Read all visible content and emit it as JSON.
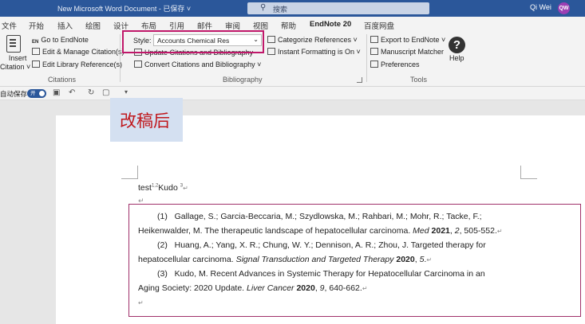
{
  "titlebar": {
    "doc_title": "New Microsoft Word Document  -  已保存  ˅",
    "search_placeholder": "搜索",
    "user_name": "Qi Wei",
    "avatar_initials": "QW"
  },
  "menu": {
    "tabs": [
      "文件",
      "开始",
      "插入",
      "绘图",
      "设计",
      "布局",
      "引用",
      "邮件",
      "审阅",
      "视图",
      "帮助",
      "EndNote 20",
      "百度网盘"
    ]
  },
  "ribbon": {
    "citations": {
      "insert_label_1": "Insert",
      "insert_label_2": "Citation ˅",
      "go_to": "Go to EndNote",
      "edit_manage": "Edit & Manage Citation(s)",
      "edit_library": "Edit Library Reference(s)",
      "group_label": "Citations"
    },
    "bibliography": {
      "style_label": "Style:",
      "style_value": "Accounts Chemical Res",
      "update": "Update Citations and Bibliography",
      "convert": "Convert Citations and Bibliography ˅",
      "categorize": "Categorize References ˅",
      "instant": "Instant Formatting is On ˅",
      "group_label": "Bibliography"
    },
    "tools": {
      "export": "Export to EndNote ˅",
      "matcher": "Manuscript Matcher",
      "preferences": "Preferences",
      "help": "Help",
      "group_label": "Tools"
    }
  },
  "qat": {
    "autosave": "自动保存",
    "toggle": "开"
  },
  "document": {
    "note": "改稿后",
    "body_text_1": "test",
    "sup_1": "1,2",
    "body_text_2": "Kudo ",
    "sup_2": "3",
    "references": [
      {
        "line1_num": "(1)",
        "line1": "Gallage, S.; Garcia-Beccaria, M.; Szydlowska, M.; Rahbari, M.; Mohr, R.; Tacke, F.;",
        "line2_pre": "Heikenwalder, M. The therapeutic landscape of hepatocellular carcinoma. ",
        "journal": "Med",
        "year": "2021",
        "volume": "2",
        "pages": "505-552."
      },
      {
        "line1_num": "(2)",
        "line1": "Huang, A.; Yang, X. R.; Chung, W. Y.; Dennison, A. R.; Zhou, J. Targeted therapy for",
        "line2_pre": "hepatocellular carcinoma. ",
        "journal": "Signal Transduction and Targeted Therapy",
        "year": "2020",
        "volume": "5",
        "pages": "."
      },
      {
        "line1_num": "(3)",
        "line1": "Kudo, M. Recent Advances in Systemic Therapy for Hepatocellular Carcinoma in an",
        "line2_pre": "Aging Society: 2020 Update. ",
        "journal": "Liver Cancer",
        "year": "2020",
        "volume": "9",
        "pages": "640-662."
      }
    ]
  }
}
